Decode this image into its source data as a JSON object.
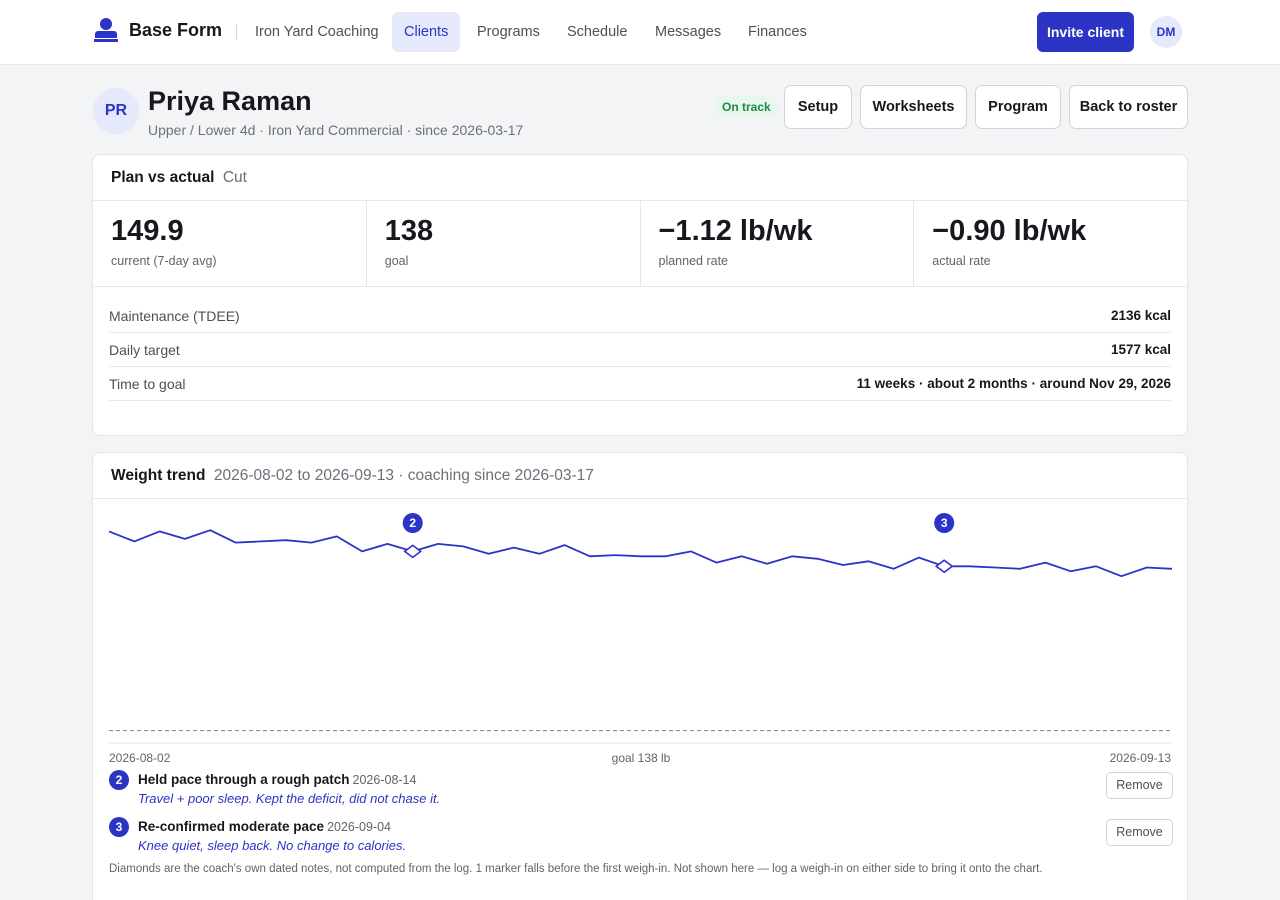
{
  "nav": {
    "brand": "Base Form",
    "org": "Iron Yard Coaching",
    "items": [
      "Clients",
      "Programs",
      "Schedule",
      "Messages",
      "Finances"
    ],
    "active": "Clients",
    "invite_label": "Invite client",
    "user_initials": "DM"
  },
  "client": {
    "initials": "PR",
    "name": "Priya Raman",
    "subtitle": "Upper / Lower 4d · Iron Yard Commercial · since 2026-03-17",
    "status": "On track",
    "actions": [
      "Setup",
      "Worksheets",
      "Program",
      "Back to roster"
    ]
  },
  "plan": {
    "title": "Plan vs actual",
    "phase": "Cut",
    "stats": [
      {
        "value": "149.9",
        "label": "current (7-day avg)"
      },
      {
        "value": "138",
        "label": "goal"
      },
      {
        "value": "−1.12 lb/wk",
        "label": "planned rate"
      },
      {
        "value": "−0.90 lb/wk",
        "label": "actual rate"
      }
    ],
    "details": [
      {
        "key": "Maintenance (TDEE)",
        "value": "2136 kcal"
      },
      {
        "key": "Daily target",
        "value": "1577 kcal"
      },
      {
        "key": "Time to goal",
        "value": "11 weeks · about 2 months · around Nov 29, 2026"
      }
    ]
  },
  "trend": {
    "title": "Weight trend",
    "subtitle": "2026-08-02 to 2026-09-13 · coaching since 2026-03-17",
    "x_start_label": "2026-08-02",
    "x_end_label": "2026-09-13",
    "goal_label": "goal 138 lb",
    "notes": [
      {
        "id": "2",
        "title": "Held pace through a rough patch",
        "date": "2026-08-14",
        "body": "Travel + poor sleep. Kept the deficit, did not chase it.",
        "remove_label": "Remove"
      },
      {
        "id": "3",
        "title": "Re-confirmed moderate pace",
        "date": "2026-09-04",
        "body": "Knee quiet, sleep back. No change to calories.",
        "remove_label": "Remove"
      }
    ],
    "footnote": "Diamonds are the coach's own dated notes, not computed from the log. 1 marker falls before the first weigh-in. Not shown here — log a weigh-in on either side to bring it onto the chart."
  },
  "colors": {
    "accent": "#2b34c4",
    "status_green": "#1d8a47"
  },
  "chart_data": {
    "type": "line",
    "x": [
      "2026-08-02",
      "2026-08-03",
      "2026-08-04",
      "2026-08-05",
      "2026-08-06",
      "2026-08-07",
      "2026-08-08",
      "2026-08-09",
      "2026-08-10",
      "2026-08-11",
      "2026-08-12",
      "2026-08-13",
      "2026-08-14",
      "2026-08-15",
      "2026-08-16",
      "2026-08-17",
      "2026-08-18",
      "2026-08-19",
      "2026-08-20",
      "2026-08-21",
      "2026-08-22",
      "2026-08-23",
      "2026-08-24",
      "2026-08-25",
      "2026-08-26",
      "2026-08-27",
      "2026-08-28",
      "2026-08-29",
      "2026-08-30",
      "2026-08-31",
      "2026-09-01",
      "2026-09-02",
      "2026-09-03",
      "2026-09-04",
      "2026-09-05",
      "2026-09-06",
      "2026-09-07",
      "2026-09-08",
      "2026-09-09",
      "2026-09-10",
      "2026-09-11",
      "2026-09-12",
      "2026-09-13"
    ],
    "series": [
      {
        "values": [
          154.0,
          153.2,
          154.0,
          153.4,
          154.1,
          153.1,
          153.2,
          153.3,
          153.1,
          153.6,
          152.4,
          153.0,
          152.4,
          153.0,
          152.8,
          152.2,
          152.7,
          152.2,
          152.9,
          152.0,
          152.1,
          152.0,
          152.0,
          152.4,
          151.5,
          152.0,
          151.4,
          152.0,
          151.8,
          151.3,
          151.6,
          151.0,
          151.9,
          151.2,
          151.2,
          151.1,
          151.0,
          151.5,
          150.8,
          151.2,
          150.4,
          151.1,
          151.0
        ]
      }
    ],
    "markers": [
      {
        "id": "2",
        "date": "2026-08-14"
      },
      {
        "id": "3",
        "date": "2026-09-04"
      }
    ],
    "goal": 138,
    "ylim": [
      137,
      155
    ]
  }
}
